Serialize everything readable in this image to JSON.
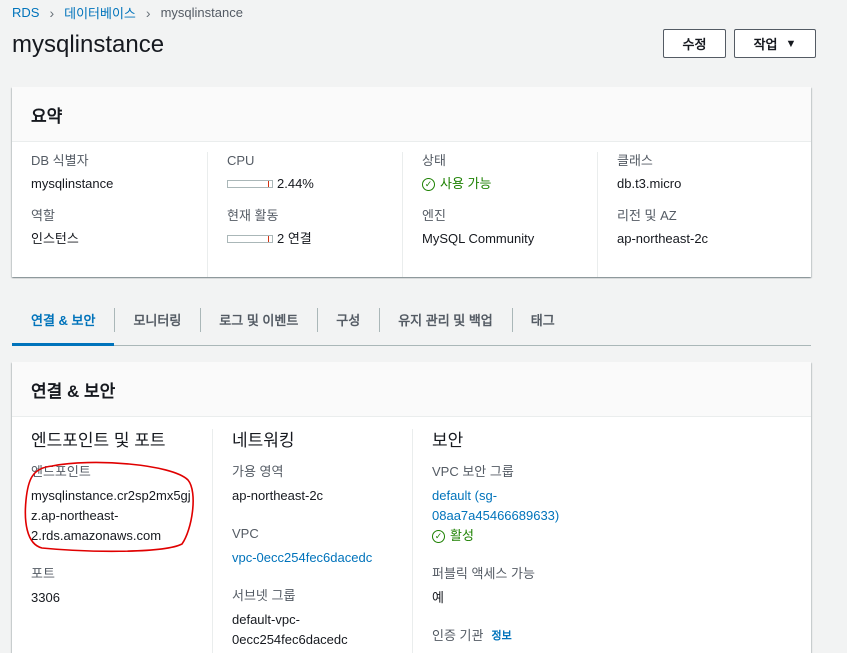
{
  "breadcrumb": [
    "RDS",
    "데이터베이스",
    "mysqlinstance"
  ],
  "page_title": "mysqlinstance",
  "buttons": {
    "edit": "수정",
    "actions": "작업"
  },
  "summary": {
    "title": "요약",
    "db_id_label": "DB 식별자",
    "db_id": "mysqlinstance",
    "role_label": "역할",
    "role": "인스턴스",
    "cpu_label": "CPU",
    "cpu": "2.44%",
    "activity_label": "현재 활동",
    "activity": "2 연결",
    "status_label": "상태",
    "status": "사용 가능",
    "engine_label": "엔진",
    "engine": "MySQL Community",
    "class_label": "클래스",
    "class": "db.t3.micro",
    "region_label": "리전 및 AZ",
    "region": "ap-northeast-2c"
  },
  "tabs": [
    "연결 & 보안",
    "모니터링",
    "로그 및 이벤트",
    "구성",
    "유지 관리 및 백업",
    "태그"
  ],
  "connectivity": {
    "title": "연결 & 보안",
    "endpoint_section": "엔드포인트 및 포트",
    "endpoint_label": "엔드포인트",
    "endpoint": "mysqlinstance.cr2sp2mx5gjz.ap-northeast-2.rds.amazonaws.com",
    "endpoint_lines": [
      "mysqlinstance.cr2sp2mx5gj",
      "z.ap-northeast-",
      "2.rds.amazonaws.com"
    ],
    "port_label": "포트",
    "port": "3306",
    "network_section": "네트워킹",
    "az_label": "가용 영역",
    "az": "ap-northeast-2c",
    "vpc_label": "VPC",
    "vpc": "vpc-0ecc254fec6dacedc",
    "subnet_label": "서브넷 그룹",
    "subnet_lines": [
      "default-vpc-",
      "0ecc254fec6dacedc"
    ],
    "security_section": "보안",
    "sg_label": "VPC 보안 그룹",
    "sg_lines": [
      "default (sg-",
      "08aa7a45466689633)"
    ],
    "sg_status": "활성",
    "public_label": "퍼블릭 액세스 가능",
    "public": "예",
    "ca_label": "인증 기관",
    "info": "정보"
  },
  "colors": {
    "accent": "#0073bb",
    "success": "#1d8102",
    "annotation": "#e00000"
  }
}
